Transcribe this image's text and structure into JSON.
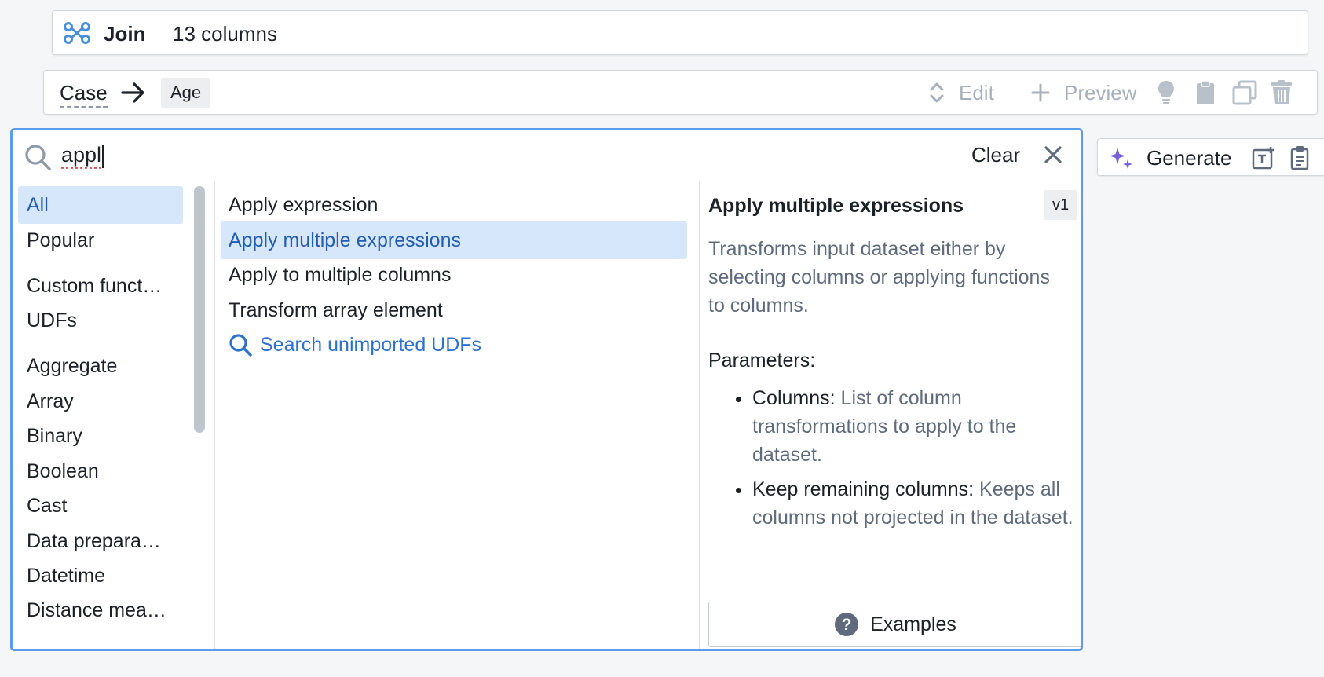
{
  "join": {
    "title": "Join",
    "columns": "13 columns"
  },
  "case_row": {
    "label": "Case",
    "target_tag": "Age",
    "edit_label": "Edit",
    "preview_label": "Preview"
  },
  "search": {
    "query": "appl",
    "clear_label": "Clear"
  },
  "categories": {
    "group1": [
      "All",
      "Popular"
    ],
    "group2": [
      "Custom funct…",
      "UDFs"
    ],
    "group3": [
      "Aggregate",
      "Array",
      "Binary",
      "Boolean",
      "Cast",
      "Data prepara…",
      "Datetime",
      "Distance mea…"
    ],
    "selected": "All"
  },
  "results": {
    "items": [
      "Apply expression",
      "Apply multiple expressions",
      "Apply to multiple columns",
      "Transform array element"
    ],
    "selected": "Apply multiple expressions",
    "search_unimported": "Search unimported UDFs"
  },
  "detail": {
    "title": "Apply multiple expressions",
    "version": "v1",
    "description": "Transforms input dataset either by selecting columns or applying functions to columns.",
    "parameters_heading": "Parameters:",
    "params": [
      {
        "name": "Columns:",
        "desc": "List of column transformations to apply to the dataset."
      },
      {
        "name": "Keep remaining columns:",
        "desc": "Keeps all columns not projected in the dataset."
      }
    ],
    "examples_label": "Examples"
  },
  "generate": {
    "label": "Generate"
  },
  "colors": {
    "accent": "#2d72d2",
    "selection_bg": "#d6e6fb",
    "focus_border": "#5b9bf0",
    "generate_sparkle": "#7961db"
  },
  "icons": [
    "join-icon",
    "arrow-right-icon",
    "expand-icon",
    "plus-icon",
    "lightbulb-icon",
    "clipboard-icon",
    "duplicate-icon",
    "trash-icon",
    "search-icon",
    "close-icon",
    "help-icon",
    "sparkle-icon",
    "add-text-icon",
    "paste-icon"
  ]
}
